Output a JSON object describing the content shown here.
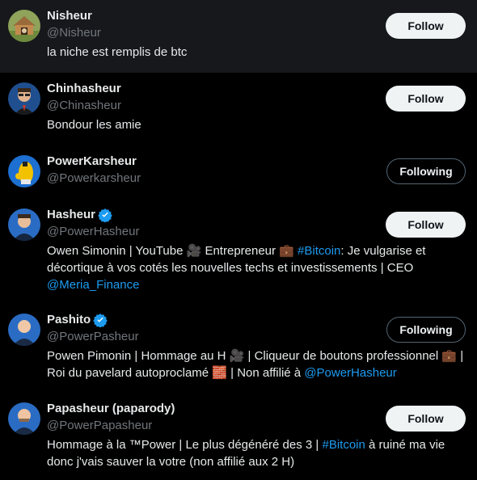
{
  "accounts": [
    {
      "name": "Nisheur",
      "handle": "@Nisheur",
      "verified": false,
      "button": "Follow",
      "bio_parts": [
        {
          "text": "la niche est remplis de btc",
          "link": false
        }
      ]
    },
    {
      "name": "Chinhasheur",
      "handle": "@Chinasheur",
      "verified": false,
      "button": "Follow",
      "bio_parts": [
        {
          "text": "Bondour les amie",
          "link": false
        }
      ]
    },
    {
      "name": "PowerKarsheur",
      "handle": "@Powerkarsheur",
      "verified": false,
      "button": "Following",
      "bio_parts": []
    },
    {
      "name": "Hasheur",
      "handle": "@PowerHasheur",
      "verified": true,
      "button": "Follow",
      "bio_parts": [
        {
          "text": "Owen Simonin | YouTube 🎥 Entrepreneur 💼 ",
          "link": false
        },
        {
          "text": "#Bitcoin",
          "link": true
        },
        {
          "text": ": Je vulgarise et décortique à vos cotés les nouvelles techs et investissements | CEO ",
          "link": false
        },
        {
          "text": "@Meria_Finance",
          "link": true
        }
      ]
    },
    {
      "name": "Pashito",
      "handle": "@PowerPasheur",
      "verified": true,
      "button": "Following",
      "bio_parts": [
        {
          "text": "Powen Pimonin | Hommage au H 🎥 | Cliqueur de boutons professionnel 💼 | Roi du pavelard autoproclamé 🧱 | Non affilié à ",
          "link": false
        },
        {
          "text": "@PowerHasheur",
          "link": true
        }
      ]
    },
    {
      "name": "Papasheur (paparody)",
      "handle": "@PowerPapasheur",
      "verified": false,
      "button": "Follow",
      "bio_parts": [
        {
          "text": "Hommage à la ™Power | Le plus dégénéré des 3 | ",
          "link": false
        },
        {
          "text": "#Bitcoin",
          "link": true
        },
        {
          "text": " à ruiné ma vie donc j'vais sauver la votre (non affilié aux 2 H)",
          "link": false
        }
      ]
    }
  ],
  "colors": {
    "background": "#000000",
    "hover_row": "#16181c",
    "text": "#e7e9ea",
    "secondary": "#71767b",
    "link": "#1d9bf0",
    "verified": "#1d9bf0"
  }
}
